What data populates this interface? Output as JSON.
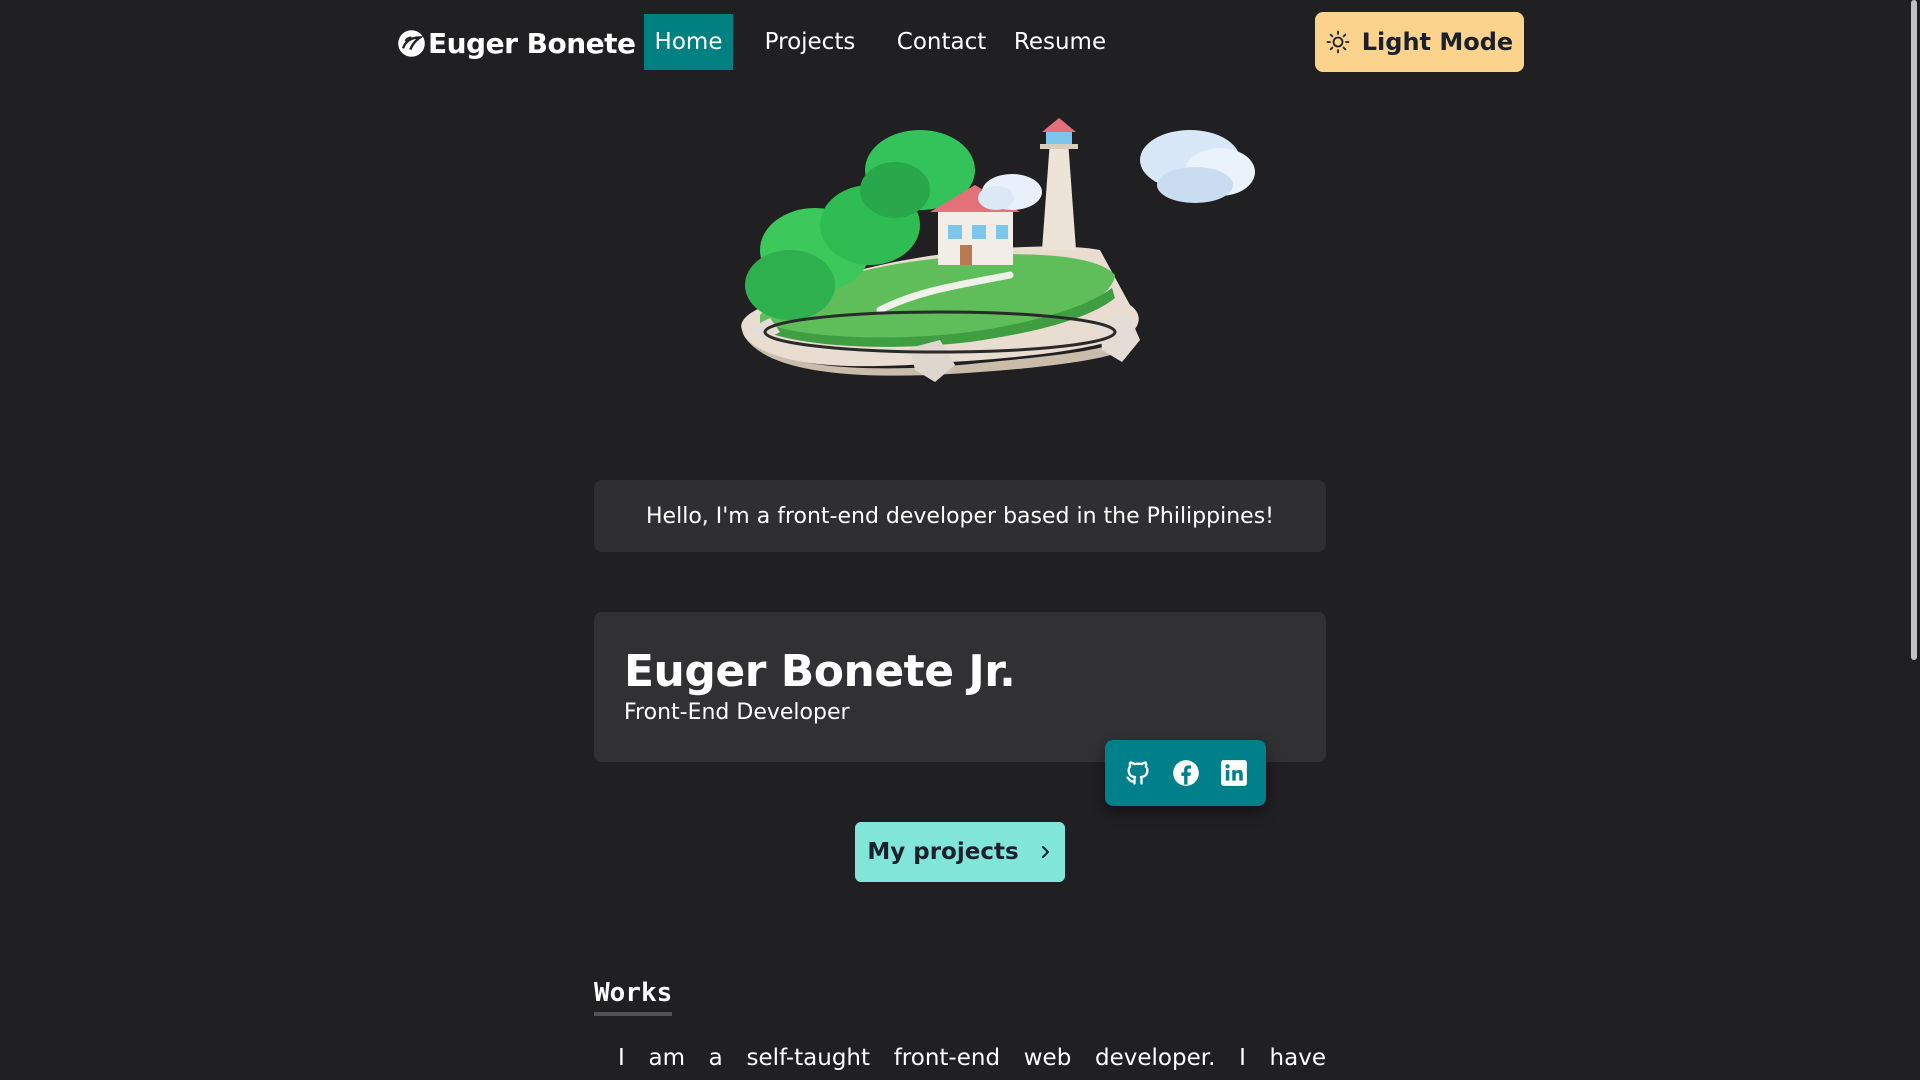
{
  "nav": {
    "logo_text": "Euger Bonete",
    "logo_icon": "leaf-icon",
    "links": [
      {
        "label": "Home",
        "active": true
      },
      {
        "label": "Projects",
        "active": false
      },
      {
        "label": "Contact",
        "active": false
      },
      {
        "label": "Resume",
        "active": false
      }
    ],
    "theme_button": {
      "label": "Light Mode",
      "icon": "sun-icon"
    }
  },
  "hero": {
    "illustration": "floating-island-with-lighthouse-and-house"
  },
  "greeting": "Hello, I'm a front-end developer based in the Philippines!",
  "profile": {
    "name": "Euger Bonete Jr.",
    "role": "Front-End Developer",
    "socials": [
      "github-icon",
      "facebook-icon",
      "linkedin-icon"
    ]
  },
  "cta": {
    "label": "My projects",
    "icon": "chevron-right-icon"
  },
  "works": {
    "title": "Works",
    "text": "I am a self-taught front-end web developer. I have relevant"
  },
  "colors": {
    "background": "#202023",
    "accent_teal": "#008080",
    "theme_button": "#fbd38d",
    "cta_button": "#81e6d9",
    "card": "#313134"
  }
}
